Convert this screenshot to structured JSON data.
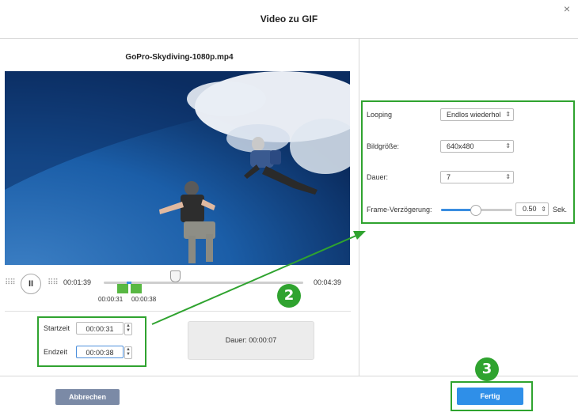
{
  "dialog": {
    "title": "Video zu GIF",
    "close_glyph": "×"
  },
  "video": {
    "filename": "GoPro-Skydiving-1080p.mp4"
  },
  "player": {
    "pause_glyph": "II",
    "current_time": "00:01:39",
    "total_time": "00:04:39",
    "range_start_label": "00:00:31",
    "range_end_label": "00:00:38"
  },
  "range": {
    "start_label": "Startzeit",
    "start_value": "00:00:31",
    "end_label": "Endzeit",
    "end_value": "00:00:38",
    "duration_label": "Dauer:",
    "duration_value": "00:00:07"
  },
  "settings": {
    "looping_label": "Looping",
    "looping_value": "Endlos wiederhol",
    "size_label": "Bildgröße:",
    "size_value": "640x480",
    "duration_label": "Dauer:",
    "duration_value": "7",
    "delay_label": "Frame-Verzögerung:",
    "delay_value": "0.50",
    "delay_unit": "Sek."
  },
  "annotations": {
    "badge_2": "2",
    "badge_3": "3",
    "accent": "#2fa32f"
  },
  "footer": {
    "cancel_label": "Abbrechen",
    "done_label": "Fertig"
  }
}
